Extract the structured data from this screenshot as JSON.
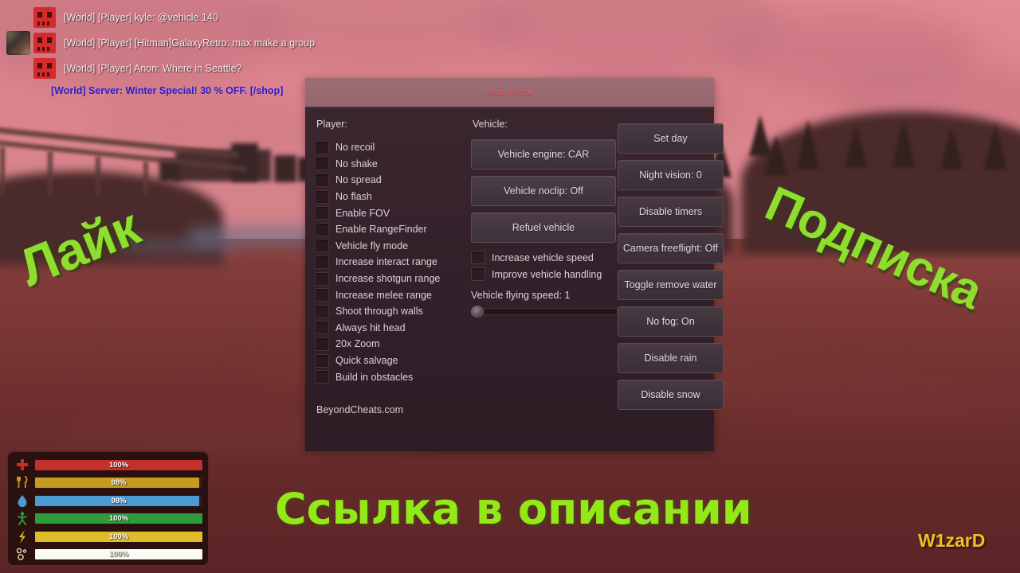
{
  "scene": {
    "description": "blurred survival game sunset landscape"
  },
  "chat": {
    "messages": [
      {
        "icon": "player-badge-icon",
        "avatar": false,
        "text": "[World] [Player] kyle: @vehicle 140",
        "type": "player"
      },
      {
        "icon": "player-badge-icon",
        "avatar": true,
        "text": "[World] [Player] [Hitman]GalaxyRetro: max make a group",
        "type": "player"
      },
      {
        "icon": "player-badge-icon",
        "avatar": false,
        "text": "[World] [Player] Anon: Where in Seattle?",
        "type": "player"
      }
    ],
    "server_message": "[World] Server: Winter Special! 30 % OFF. [/shop]",
    "server_color": "#2a1ad0"
  },
  "menu": {
    "title": "Main menu",
    "title_color": "#e0606a",
    "player": {
      "heading": "Player:",
      "checkboxes": [
        {
          "label": "No recoil",
          "checked": false
        },
        {
          "label": "No shake",
          "checked": false
        },
        {
          "label": "No spread",
          "checked": false
        },
        {
          "label": "No flash",
          "checked": false
        },
        {
          "label": "Enable FOV",
          "checked": false
        },
        {
          "label": "Enable RangeFinder",
          "checked": false
        },
        {
          "label": "Vehicle fly mode",
          "checked": false
        },
        {
          "label": "Increase interact range",
          "checked": false
        },
        {
          "label": "Increase shotgun range",
          "checked": false
        },
        {
          "label": "Increase melee range",
          "checked": false
        },
        {
          "label": "Shoot through walls",
          "checked": false
        },
        {
          "label": "Always hit head",
          "checked": false
        },
        {
          "label": "20x Zoom",
          "checked": false
        },
        {
          "label": "Quick salvage",
          "checked": false
        },
        {
          "label": "Build in obstacles",
          "checked": false
        }
      ],
      "watermark": "BeyondCheats.com"
    },
    "vehicle": {
      "heading": "Vehicle:",
      "buttons": [
        {
          "label": "Vehicle engine: CAR"
        },
        {
          "label": "Vehicle noclip: Off"
        },
        {
          "label": "Refuel vehicle"
        }
      ],
      "checkboxes": [
        {
          "label": "Increase vehicle speed",
          "checked": false
        },
        {
          "label": "Improve vehicle handling",
          "checked": false
        }
      ],
      "slider": {
        "label": "Vehicle flying speed: 1",
        "value": 1,
        "percent": 0
      }
    },
    "world": {
      "buttons": [
        {
          "label": "Set day"
        },
        {
          "label": "Night vision: 0"
        },
        {
          "label": "Disable timers"
        },
        {
          "label": "Camera freeflight: Off"
        },
        {
          "label": "Toggle remove water"
        },
        {
          "label": "No fog: On"
        },
        {
          "label": "Disable rain"
        },
        {
          "label": "Disable snow"
        }
      ]
    }
  },
  "status_bars": [
    {
      "icon": "health-cross-icon",
      "value": "100%",
      "color": "#c4302b",
      "fill": 100
    },
    {
      "icon": "food-fork-knife-icon",
      "value": "98%",
      "color": "#c79a20",
      "fill": 98
    },
    {
      "icon": "water-drop-icon",
      "value": "98%",
      "color": "#4a9bd1",
      "fill": 98
    },
    {
      "icon": "stamina-figure-icon",
      "value": "100%",
      "color": "#2e9b3c",
      "fill": 100
    },
    {
      "icon": "energy-bolt-icon",
      "value": "100%",
      "color": "#e0bb2a",
      "fill": 100
    },
    {
      "icon": "radiation-icon",
      "value": "100%",
      "color": "#fbfbf5",
      "fill": 100
    }
  ],
  "overlays": {
    "like": "Лайк",
    "subscribe": "Подписка",
    "link_in_description": "Ссылка в описании",
    "nickname": "W1zarD",
    "accent_green": "#8ede2e",
    "nick_color": "#f0c020"
  }
}
